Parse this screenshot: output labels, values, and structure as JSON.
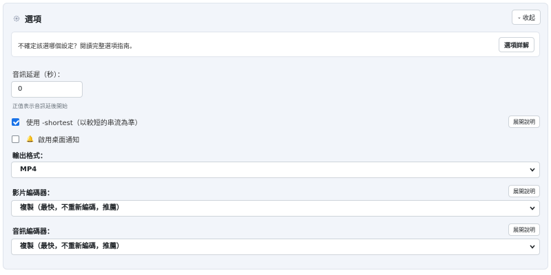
{
  "header": {
    "title": "選項",
    "collapse_label": "收起"
  },
  "info": {
    "text": "不確定該選哪個設定？閱讀完整選項指南。",
    "details_label": "選項詳解"
  },
  "audio_delay": {
    "label": "音訊延遲（秒）：",
    "value": "0",
    "hint": "正值表示音訊延後開始"
  },
  "shortest": {
    "checked": true,
    "label": "使用 -shortest（以較短的串流為準）",
    "expand_label": "展開說明"
  },
  "desktop_notify": {
    "checked": false,
    "label": "啟用桌面通知"
  },
  "output_format": {
    "label": "輸出格式：",
    "selected": "MP4"
  },
  "video_encoder": {
    "label": "影片編碼器：",
    "selected": "複製（最快，不重新編碼，推薦）",
    "expand_label": "展開說明"
  },
  "audio_encoder": {
    "label": "音訊編碼器：",
    "selected": "複製（最快，不重新編碼，推薦）",
    "expand_label": "展開說明"
  },
  "colors": {
    "panel_bg": "#f2f5fa",
    "checkbox_accent": "#1a73e8"
  },
  "icons": {
    "title_icon": "gear-icon",
    "notify_icon": "bell-icon",
    "select_icon": "chevron-down-icon"
  }
}
